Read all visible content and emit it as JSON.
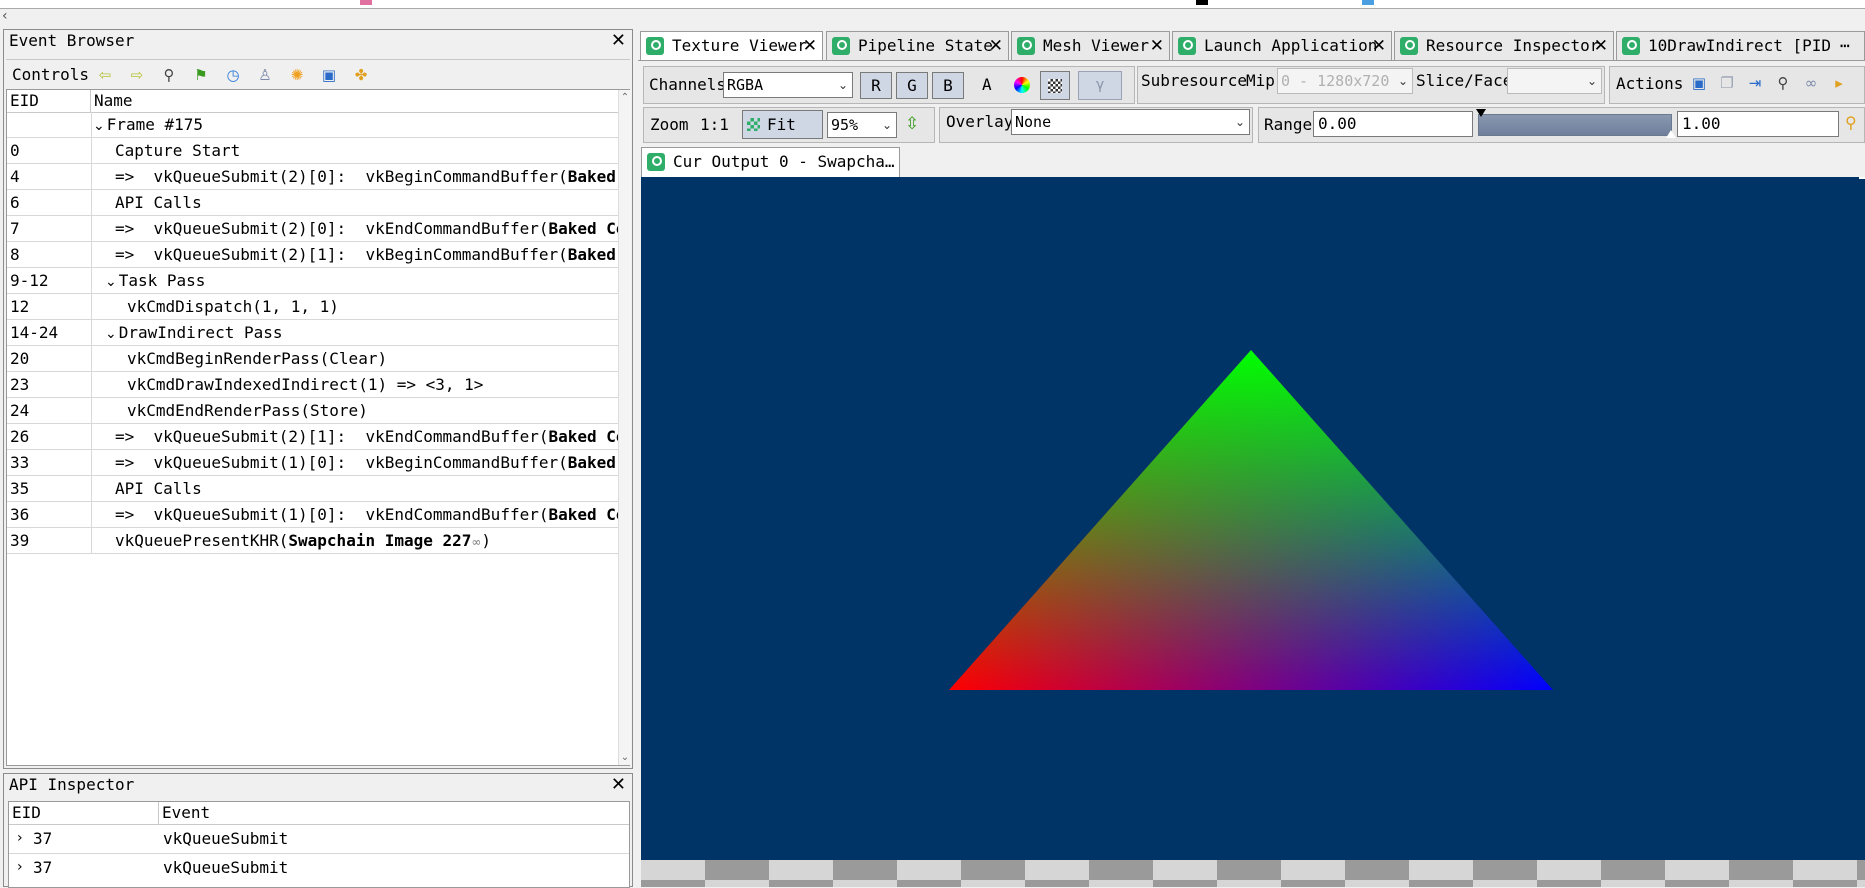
{
  "event_browser": {
    "title": "Event Browser",
    "controls_label": "Controls",
    "columns": [
      "EID",
      "Name"
    ],
    "rows": [
      {
        "eid": "",
        "indent": 0,
        "toggle": "⌄",
        "text": "Frame #175",
        "bold": ""
      },
      {
        "eid": "0",
        "indent": 1,
        "toggle": "",
        "text": "Capture Start",
        "bold": ""
      },
      {
        "eid": "4",
        "indent": 1,
        "toggle": "",
        "text": "=>  vkQueueSubmit(2)[0]:  vkBeginCommandBuffer(",
        "bold": "Baked Co"
      },
      {
        "eid": "6",
        "indent": 1,
        "toggle": "",
        "text": "API Calls",
        "bold": ""
      },
      {
        "eid": "7",
        "indent": 1,
        "toggle": "",
        "text": "=>  vkQueueSubmit(2)[0]:  vkEndCommandBuffer(",
        "bold": "Baked Comm"
      },
      {
        "eid": "8",
        "indent": 1,
        "toggle": "",
        "text": "=>  vkQueueSubmit(2)[1]:  vkBeginCommandBuffer(",
        "bold": "Baked Co"
      },
      {
        "eid": "9-12",
        "indent": 0,
        "toggle": "⌄",
        "text": "Task Pass",
        "bold": ""
      },
      {
        "eid": "12",
        "indent": 2,
        "toggle": "",
        "text": "vkCmdDispatch(1, 1, 1)",
        "bold": ""
      },
      {
        "eid": "14-24",
        "indent": 0,
        "toggle": "⌄",
        "text": "DrawIndirect Pass",
        "bold": ""
      },
      {
        "eid": "20",
        "indent": 2,
        "toggle": "",
        "text": "vkCmdBeginRenderPass(Clear)",
        "bold": ""
      },
      {
        "eid": "23",
        "indent": 2,
        "toggle": "",
        "text": "vkCmdDrawIndexedIndirect(1) => <3, 1>",
        "bold": ""
      },
      {
        "eid": "24",
        "indent": 2,
        "toggle": "",
        "text": "vkCmdEndRenderPass(Store)",
        "bold": ""
      },
      {
        "eid": "26",
        "indent": 1,
        "toggle": "",
        "text": "=>  vkQueueSubmit(2)[1]:  vkEndCommandBuffer(",
        "bold": "Baked Comm"
      },
      {
        "eid": "33",
        "indent": 1,
        "toggle": "",
        "text": "=>  vkQueueSubmit(1)[0]:  vkBeginCommandBuffer(",
        "bold": "Baked Co"
      },
      {
        "eid": "35",
        "indent": 1,
        "toggle": "",
        "text": "API Calls",
        "bold": ""
      },
      {
        "eid": "36",
        "indent": 1,
        "toggle": "",
        "text": "=>  vkQueueSubmit(1)[0]:  vkEndCommandBuffer(",
        "bold": "Baked Comm"
      },
      {
        "eid": "39",
        "indent": 1,
        "toggle": "",
        "text": "vkQueuePresentKHR(",
        "bold": "Swapchain Image 227",
        "suffix": ")"
      }
    ]
  },
  "api_inspector": {
    "title": "API Inspector",
    "columns": [
      "EID",
      "Event"
    ],
    "rows": [
      {
        "eid": "37",
        "event": "vkQueueSubmit"
      },
      {
        "eid": "37",
        "event": "vkQueueSubmit"
      }
    ]
  },
  "tabs": [
    {
      "label": "Texture Viewer",
      "active": true
    },
    {
      "label": "Pipeline State",
      "active": false
    },
    {
      "label": "Mesh Viewer",
      "active": false
    },
    {
      "label": "Launch Application",
      "active": false
    },
    {
      "label": "Resource Inspector",
      "active": false
    },
    {
      "label": "10DrawIndirect [PID",
      "active": false
    }
  ],
  "tab_overflow": "⋯",
  "texture_toolbar": {
    "channels_label": "Channels",
    "channels_value": "RGBA",
    "r": "R",
    "g": "G",
    "b": "B",
    "a": "A",
    "subresource_label": "Subresource",
    "mip_label": "Mip",
    "mip_value": "0 - 1280x720",
    "slice_label": "Slice/Face",
    "slice_value": "",
    "actions_label": "Actions",
    "zoom_label": "Zoom",
    "zoom_one": "1:1",
    "fit_label": "Fit",
    "zoom_value": "95%",
    "overlay_label": "Overlay",
    "overlay_value": "None",
    "range_label": "Range",
    "range_min": "0.00",
    "range_max": "1.00"
  },
  "output_tab": {
    "label": "Cur Output 0 - Swapcha…"
  },
  "colors": {
    "viewport_bg": "#003366",
    "accent_green": "#2fae6a"
  }
}
